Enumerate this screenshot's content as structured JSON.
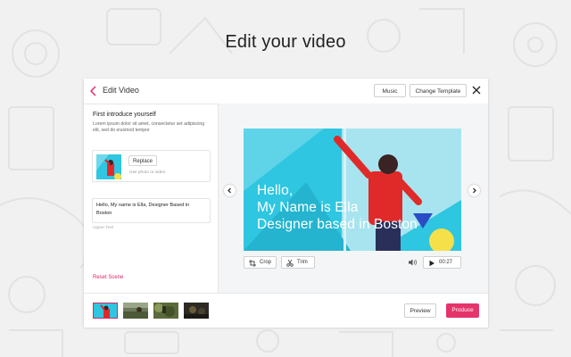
{
  "headline": "Edit your video",
  "dialog": {
    "back_label": "Edit Video",
    "music_label": "Music",
    "change_template_label": "Change Template"
  },
  "left_panel": {
    "intro_title": "First introduce yourself",
    "intro_desc": "Lorem ipsum dolor sit amet, consectetur set adipiscing elit, sed do eiusmod tempor",
    "replace_label": "Replace",
    "media_hint": "Use photo or video",
    "text_value": "Hello, My name is Ella, Designer Based in Boston",
    "text_label": "Upper Text",
    "reset_label": "Reset Scene"
  },
  "preview": {
    "overlay_lines": [
      "Hello,",
      "My Name is Ella",
      "Designer based in Boston"
    ],
    "crop_label": "Crop",
    "trim_label": "Trim",
    "time": "00:27"
  },
  "footer": {
    "preview_label": "Preview",
    "produce_label": "Produce"
  },
  "colors": {
    "accent": "#e0245e",
    "produce_bg": "#e5336b",
    "preview_bg": "#2ec6e0"
  }
}
